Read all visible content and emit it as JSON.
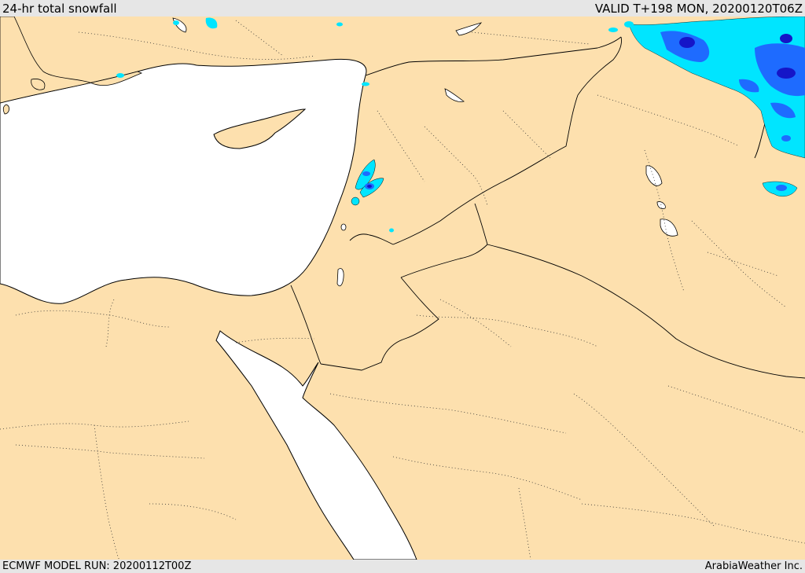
{
  "header": {
    "title": "24-hr total snowfall",
    "valid": "VALID T+198 MON, 20200120T06Z"
  },
  "footer": {
    "model_run": "ECMWF MODEL RUN: 20200112T00Z",
    "credit": "ArabiaWeather Inc."
  },
  "colors": {
    "land": "#fde0ae",
    "water": "#ffffff",
    "coast": "#000000",
    "border": "#000000",
    "snow_light": "#00e5ff",
    "snow_mid": "#1e6bff",
    "snow_heavy": "#1515c8"
  }
}
